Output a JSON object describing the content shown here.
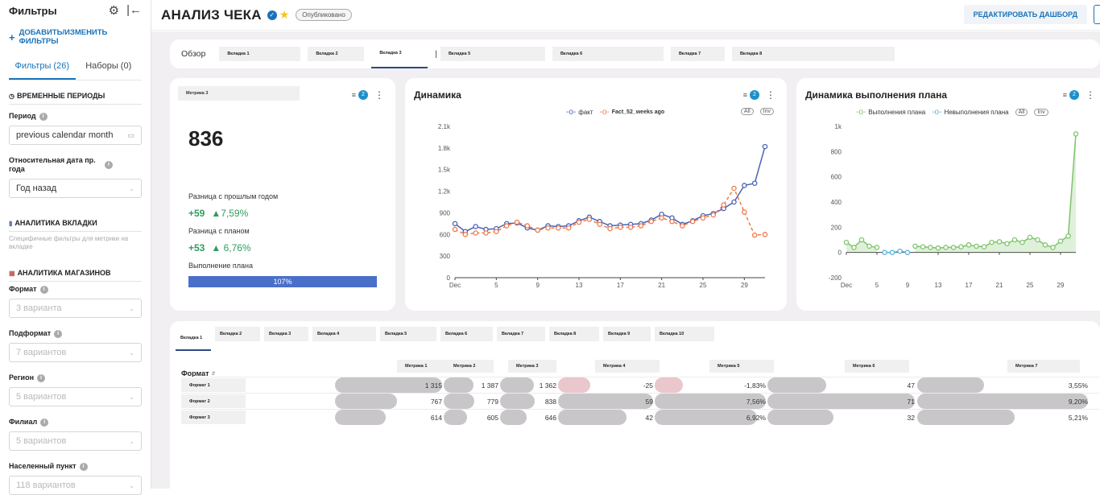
{
  "sidebar": {
    "title": "Фильтры",
    "add_label": "ДОБАВИТЬ/ИЗМЕНИТЬ ФИЛЬТРЫ",
    "tab_filters": "Фильтры (26)",
    "tab_sets": "Наборы (0)",
    "sections": {
      "time": "ВРЕМЕННЫЕ ПЕРИОДЫ",
      "tab_analytics": "АНАЛИТИКА ВКЛАДКИ",
      "tab_analytics_desc": "Специфичные фильтры для метрики на вкладке",
      "store_analytics": "АНАЛИТИКА МАГАЗИНОВ"
    },
    "filters": {
      "period_label": "Период",
      "period_value": "previous calendar month",
      "rel_date_label": "Относительная дата пр. года",
      "rel_date_value": "Год назад",
      "format_label": "Формат",
      "format_value": "3 варианта",
      "subformat_label": "Подформат",
      "subformat_value": "7 вариантов",
      "region_label": "Регион",
      "region_value": "5 вариантов",
      "branch_label": "Филиал",
      "branch_value": "5 вариантов",
      "city_label": "Населенный пункт",
      "city_value": "118 вариантов"
    }
  },
  "header": {
    "title": "АНАЛИЗ ЧЕКА",
    "status": "Опубликовано",
    "edit_button": "РЕДАКТИРОВАТЬ ДАШБОРД"
  },
  "dashboard_tabs": {
    "overview": "Обзор",
    "tabs": [
      "Вкладка 1",
      "Вкладка 2",
      "Вкладка 3",
      "Вкладка 5",
      "Вкладка 6",
      "Вкладка 7",
      "Вкладка 8"
    ]
  },
  "kpi": {
    "metric_label": "Метрика 3",
    "filter_count": "2",
    "value": "836",
    "yoy_label": "Разница с прошлым годом",
    "yoy_abs": "+59",
    "yoy_pct": "▲7,59%",
    "plan_label": "Разница с планом",
    "plan_abs": "+53",
    "plan_pct": "▲ 6,76%",
    "exec_label": "Выполнение плана",
    "exec_value": "107%",
    "exec_fraction": 1.0,
    "color_positive": "#2e9e5e",
    "color_bar": "#4a6fc9"
  },
  "chart_data": [
    {
      "type": "line",
      "title": "Динамика",
      "filter_count": "2",
      "legend_toggles": [
        "All",
        "Inv"
      ],
      "x": [
        1,
        2,
        3,
        4,
        5,
        6,
        7,
        8,
        9,
        10,
        11,
        12,
        13,
        14,
        15,
        16,
        17,
        18,
        19,
        20,
        21,
        22,
        23,
        24,
        25,
        26,
        27,
        28,
        29,
        30,
        31
      ],
      "xticks": [
        "Dec",
        "5",
        "9",
        "13",
        "17",
        "21",
        "25",
        "29"
      ],
      "xtick_pos": [
        1,
        5,
        9,
        13,
        17,
        21,
        25,
        29
      ],
      "ylim": [
        0,
        2100
      ],
      "yticks": [
        "0",
        "300",
        "600",
        "900",
        "1.2k",
        "1.5k",
        "1.8k",
        "2.1k"
      ],
      "ytick_vals": [
        0,
        300,
        600,
        900,
        1200,
        1500,
        1800,
        2100
      ],
      "series": [
        {
          "name": "факт",
          "color": "#4863b5",
          "dash": false,
          "values": [
            750,
            640,
            710,
            670,
            680,
            750,
            760,
            690,
            660,
            720,
            710,
            720,
            790,
            840,
            780,
            720,
            730,
            740,
            750,
            800,
            880,
            830,
            740,
            790,
            860,
            890,
            960,
            1050,
            1280,
            1310,
            1820
          ]
        },
        {
          "name": "Fact_52_weeks ago",
          "color": "#f07a4a",
          "dash": true,
          "values": [
            670,
            600,
            620,
            620,
            640,
            720,
            770,
            720,
            660,
            690,
            690,
            690,
            770,
            810,
            740,
            680,
            700,
            700,
            720,
            780,
            830,
            780,
            720,
            780,
            830,
            870,
            1010,
            1240,
            910,
            590,
            600
          ]
        }
      ]
    },
    {
      "type": "line",
      "title": "Динамика выполнения плана",
      "filter_count": "2",
      "legend_toggles": [
        "All",
        "Inv"
      ],
      "x": [
        1,
        2,
        3,
        4,
        5,
        6,
        7,
        8,
        9,
        10,
        11,
        12,
        13,
        14,
        15,
        16,
        17,
        18,
        19,
        20,
        21,
        22,
        23,
        24,
        25,
        26,
        27,
        28,
        29,
        30,
        31
      ],
      "xticks": [
        "Dec",
        "5",
        "9",
        "13",
        "17",
        "21",
        "25",
        "29"
      ],
      "xtick_pos": [
        1,
        5,
        9,
        13,
        17,
        21,
        25,
        29
      ],
      "ylim": [
        -200,
        1000
      ],
      "yticks": [
        "-200",
        "0",
        "200",
        "400",
        "600",
        "800",
        "1k"
      ],
      "ytick_vals": [
        -200,
        0,
        200,
        400,
        600,
        800,
        1000
      ],
      "series": [
        {
          "name": "Выполнения плана",
          "color": "#7ec46a",
          "values": [
            80,
            40,
            100,
            50,
            40,
            null,
            null,
            null,
            null,
            50,
            45,
            40,
            35,
            40,
            40,
            45,
            60,
            50,
            45,
            80,
            85,
            70,
            100,
            80,
            120,
            100,
            60,
            40,
            90,
            130,
            940
          ]
        },
        {
          "name": "Невыполнения плана",
          "color": "#5ab3e0",
          "values": [
            null,
            null,
            null,
            null,
            null,
            0,
            0,
            10,
            0,
            null,
            null,
            null,
            null,
            null,
            null,
            null,
            null,
            null,
            null,
            null,
            null,
            null,
            null,
            null,
            null,
            null,
            null,
            null,
            null,
            null,
            null
          ]
        }
      ]
    },
    {
      "type": "table",
      "tabs": [
        "Вкладка 1",
        "Вкладка 2",
        "Вкладка 3",
        "Вкладка 4",
        "Вкладка 5",
        "Вкладка 6",
        "Вкладка 7",
        "Вкладка 8",
        "Вкладка 9",
        "Вкладка 10"
      ],
      "row_header": "Формат",
      "columns": [
        "Метрика 1",
        "Метрика 2",
        "Метрика 3",
        "Метрика 4",
        "Метрика 5",
        "Метрика 6",
        "Метрика 7"
      ],
      "rows": [
        {
          "label": "Формат 1",
          "values": [
            "1 315",
            "1 387",
            "1 362",
            "-25",
            "-1,83%",
            "47",
            "3,55%"
          ],
          "bars": [
            1.0,
            0.55,
            0.6,
            -0.34,
            -0.25,
            0.4,
            0.39
          ]
        },
        {
          "label": "Формат 2",
          "values": [
            "767",
            "779",
            "838",
            "59",
            "7,56%",
            "71",
            "9,20%"
          ],
          "bars": [
            0.58,
            0.56,
            0.62,
            1.0,
            1.0,
            1.0,
            1.0
          ]
        },
        {
          "label": "Формат 3",
          "values": [
            "614",
            "605",
            "646",
            "42",
            "6,92%",
            "32",
            "5,21%"
          ],
          "bars": [
            0.47,
            0.43,
            0.47,
            0.72,
            0.92,
            0.45,
            0.57
          ]
        }
      ]
    }
  ]
}
